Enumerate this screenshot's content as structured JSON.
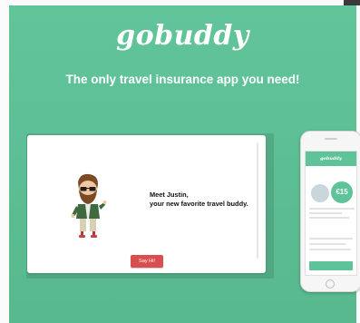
{
  "brand": {
    "logo_text": "gobuddy"
  },
  "hero": {
    "tagline": "The only travel insurance app you need!"
  },
  "chat": {
    "message_line1": "Meet Justin,",
    "message_line2": "your new favorite travel buddy.",
    "button_label": "Say Hi!"
  },
  "phone_screen": {
    "app_name": "gobuddy",
    "price": "€15"
  },
  "colors": {
    "hero_green": "#5dbf95",
    "button_red": "#d94f4f",
    "text_white": "#ffffff"
  }
}
